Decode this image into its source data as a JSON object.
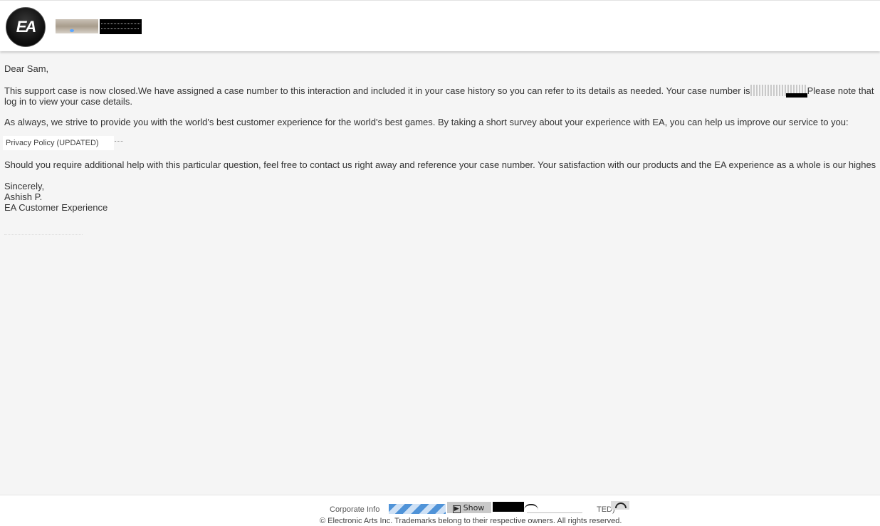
{
  "header": {
    "logo_text": "EA"
  },
  "email": {
    "greeting": "Dear Sam,",
    "closed_line1_a": "This support case is now closed.We have assigned a case number to this interaction and included it in your case history so you can refer to its details as needed. Your case number is",
    "closed_line1_b": "Please note that",
    "closed_line2": "log in to view your case details.",
    "always": "As always, we strive to provide you with the world's best customer experience for the world's best games. By taking a short survey about your experience with EA, you can help us improve our service to you:",
    "privacy_link": "Privacy Policy (UPDATED)",
    "should": "Should you require additional help with this particular question, feel free to contact us right away and reference your case number. Your satisfaction with our products and the EA experience as a whole is our highes",
    "sign_1": "Sincerely,",
    "sign_2": "Ashish P.",
    "sign_3": "EA Customer Experience"
  },
  "footer": {
    "corporate_info": "Corporate Info",
    "show_label": "Show",
    "ted_fragment": "TED)",
    "copyright": "© Electronic Arts Inc. Trademarks belong to their respective owners. All rights reserved."
  },
  "colors": {
    "page_bg": "#f5f5f5",
    "header_bg": "#ffffff",
    "text": "#333333"
  },
  "icons": [
    "ea-logo",
    "play-icon",
    "wifi-icon"
  ]
}
